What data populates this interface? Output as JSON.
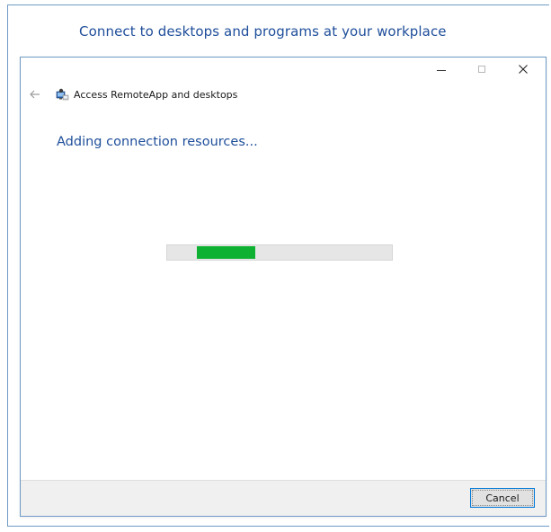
{
  "wizard": {
    "heading": "Connect to desktops and programs at your workplace"
  },
  "dialog": {
    "title_buttons": {
      "minimize_icon": "minimize-icon",
      "maximize_icon": "maximize-icon",
      "close_icon": "close-icon",
      "close_glyph": "✕"
    },
    "nav": {
      "back_icon": "back-arrow-icon",
      "app_icon": "remoteapp-icon",
      "title": "Access RemoteApp and desktops"
    },
    "status": "Adding connection resources...",
    "progress": {
      "style": "marquee",
      "chunk_start_fraction": 0.13,
      "chunk_fraction": 0.26,
      "fill_color": "#0fb132",
      "track_color": "#e6e6e6"
    },
    "footer": {
      "cancel_label": "Cancel"
    }
  },
  "colors": {
    "heading": "#1e4e9a",
    "frame_border": "#6d9ac4",
    "footer_bg": "#f0f0f0",
    "button_focus_border": "#0078d7"
  }
}
